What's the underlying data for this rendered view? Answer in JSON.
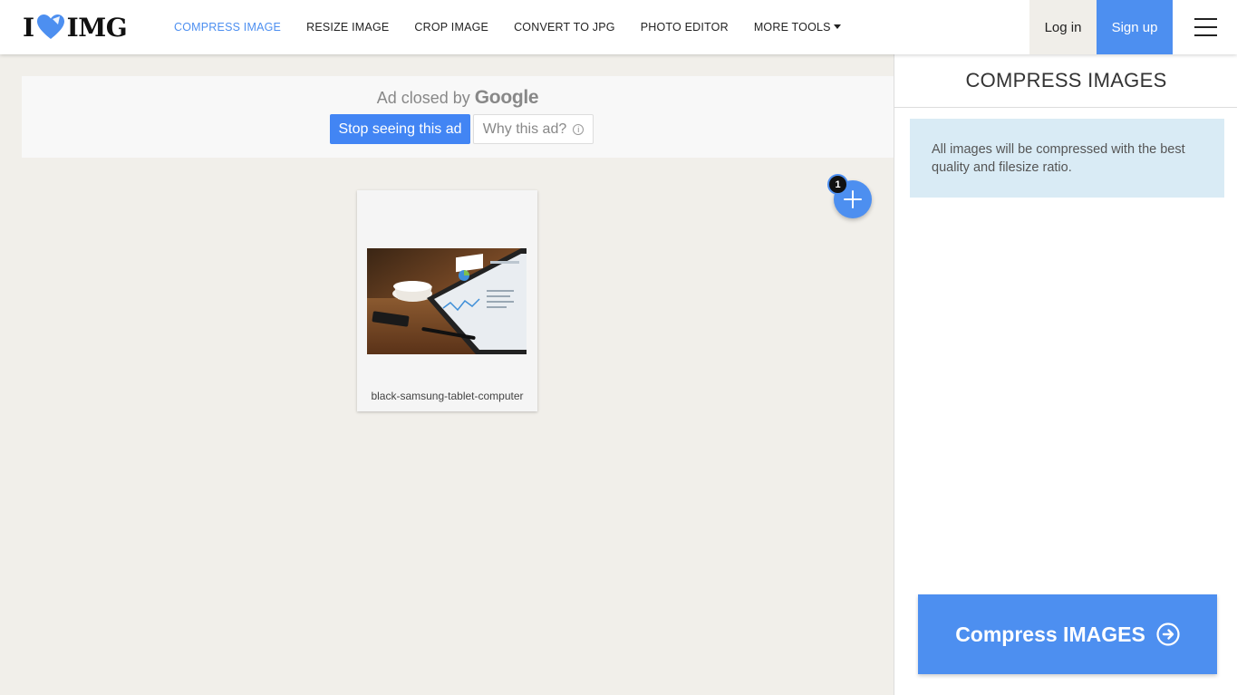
{
  "brand": {
    "logo_left": "I",
    "logo_right": "IMG",
    "accent": "#4d8ff0"
  },
  "nav": {
    "items": [
      {
        "label": "COMPRESS IMAGE",
        "active": true
      },
      {
        "label": "RESIZE IMAGE",
        "active": false
      },
      {
        "label": "CROP IMAGE",
        "active": false
      },
      {
        "label": "CONVERT TO JPG",
        "active": false
      },
      {
        "label": "PHOTO EDITOR",
        "active": false
      },
      {
        "label": "MORE TOOLS",
        "active": false
      }
    ],
    "login": "Log in",
    "signup": "Sign up"
  },
  "ad": {
    "closed_prefix": "Ad closed by",
    "closed_brand": "Google",
    "stop_label": "Stop seeing this ad",
    "why_label": "Why this ad?",
    "info_glyph": "i"
  },
  "uploader": {
    "file_count": "1",
    "files": [
      {
        "name": "black-samsung-tablet-computer"
      }
    ]
  },
  "sidebar": {
    "title": "COMPRESS IMAGES",
    "info": "All images will be compressed with the best quality and filesize ratio.",
    "action_label": "Compress IMAGES"
  }
}
